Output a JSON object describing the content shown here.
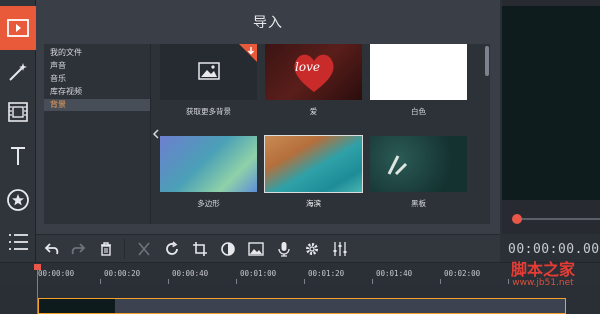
{
  "panel": {
    "title": "导入"
  },
  "folders": [
    {
      "label": "我的文件",
      "selected": false
    },
    {
      "label": "声音",
      "selected": false
    },
    {
      "label": "音乐",
      "selected": false
    },
    {
      "label": "库存视频",
      "selected": false
    },
    {
      "label": "背景",
      "selected": true
    }
  ],
  "tiles": [
    {
      "label": "获取更多背景",
      "kind": "get-more"
    },
    {
      "label": "爱",
      "kind": "love",
      "thumb_text": "love"
    },
    {
      "label": "白色",
      "kind": "white"
    },
    {
      "label": "多边形",
      "kind": "polygon"
    },
    {
      "label": "海滨",
      "kind": "beach"
    },
    {
      "label": "黑板",
      "kind": "blackboard"
    }
  ],
  "preview": {
    "timecode": "00:00:00.00"
  },
  "toolbar": {
    "buttons": [
      "undo-icon",
      "redo-icon",
      "delete-icon",
      "cut-icon",
      "rotate-icon",
      "crop-icon",
      "color-adjust-icon",
      "image-icon",
      "mic-icon",
      "settings-icon",
      "equalizer-icon"
    ]
  },
  "timeline": {
    "ticks": [
      "00:00:00",
      "00:00:20",
      "00:00:40",
      "00:01:00",
      "00:01:20",
      "00:01:40",
      "00:02:00"
    ]
  },
  "watermark": {
    "main": "脚本之家",
    "sub": "www.jb51.net"
  },
  "colors": {
    "accent": "#e85a3a",
    "clip_border": "#f2a12b",
    "selected_text": "#f2a25b"
  }
}
